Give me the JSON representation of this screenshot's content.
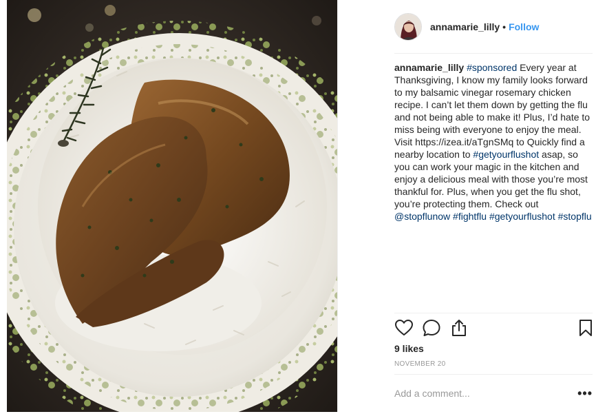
{
  "post": {
    "username": "annamarie_lilly",
    "separator": "•",
    "follow_label": "Follow",
    "caption": {
      "username": "annamarie_lilly",
      "segments": [
        {
          "type": "tag",
          "text": "#sponsored"
        },
        {
          "type": "text",
          "text": " Every year at Thanksgiving, I know my family looks forward to my balsamic vinegar rosemary chicken recipe. I can’t let them down by getting the flu and not being able to make it! Plus, I’d hate to miss being with everyone to enjoy the meal. Visit https://izea.it/aTgnSMq to Quickly find a nearby location to "
        },
        {
          "type": "tag",
          "text": "#getyourflushot"
        },
        {
          "type": "text",
          "text": " asap, so you can work your magic in the kitchen and enjoy a delicious meal with those you’re most thankful for. Plus, when you get the flu shot, you’re protecting them. Check out "
        },
        {
          "type": "tag",
          "text": "@stopflunow"
        },
        {
          "type": "text",
          "text": " "
        },
        {
          "type": "tag",
          "text": "#fightflu"
        },
        {
          "type": "text",
          "text": " "
        },
        {
          "type": "tag",
          "text": "#getyourflushot"
        },
        {
          "type": "text",
          "text": " "
        },
        {
          "type": "tag",
          "text": "#stopflu"
        }
      ]
    },
    "likes": "9 likes",
    "date": "NOVEMBER 20",
    "comment_placeholder": "Add a comment...",
    "more_label": "•••"
  },
  "icons": {
    "like": "heart-icon",
    "comment": "comment-bubble-icon",
    "share": "share-upload-icon",
    "save": "bookmark-icon",
    "avatar": "profile-avatar",
    "photo": "chicken-rice-rosemary-photo"
  },
  "colors": {
    "link_blue": "#3897f0",
    "tag_navy": "#003569",
    "muted_gray": "#999999",
    "divider": "#efefef",
    "text": "#262626"
  }
}
